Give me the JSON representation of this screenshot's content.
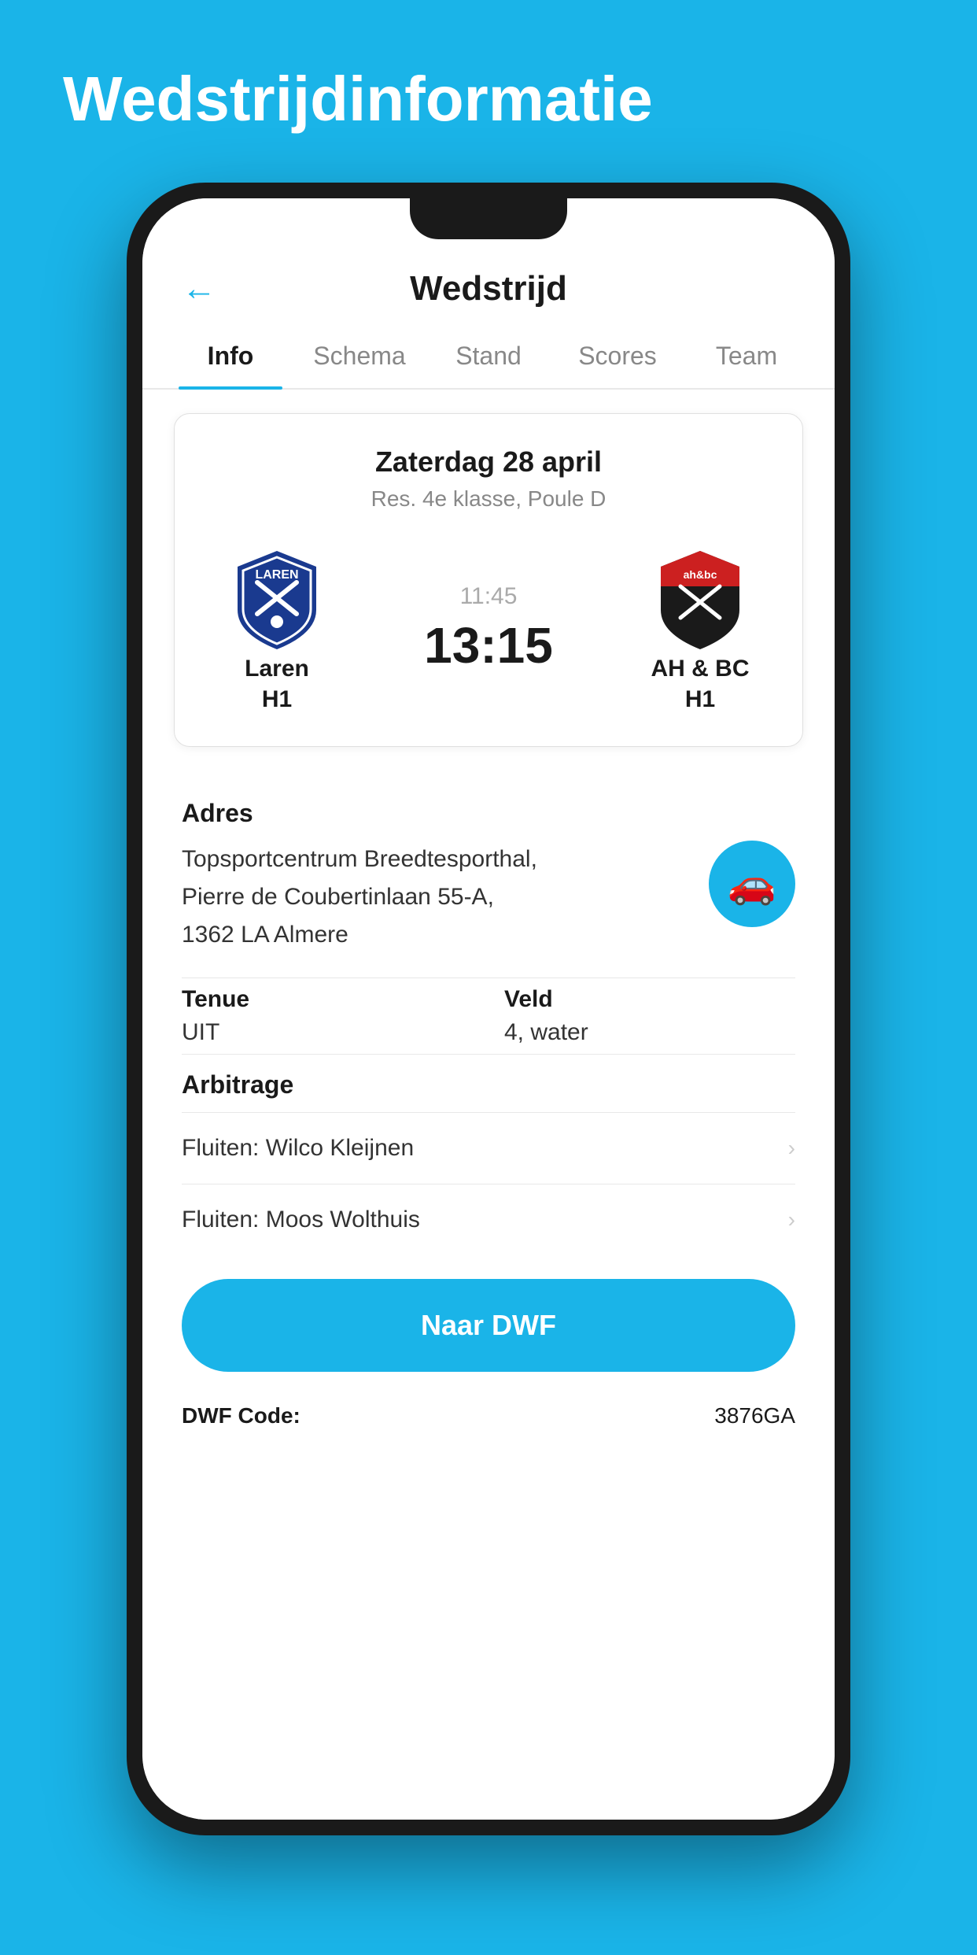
{
  "page": {
    "bg_title": "Wedstrijdinformatie",
    "header": {
      "title": "Wedstrijd",
      "back_label": "←"
    },
    "tabs": [
      {
        "label": "Info",
        "active": true
      },
      {
        "label": "Schema",
        "active": false
      },
      {
        "label": "Stand",
        "active": false
      },
      {
        "label": "Scores",
        "active": false
      },
      {
        "label": "Team",
        "active": false
      }
    ],
    "match": {
      "date": "Zaterdag 28 april",
      "league": "Res. 4e klasse, Poule D",
      "home_team": "Laren",
      "home_sub": "H1",
      "away_team": "AH & BC",
      "away_sub": "H1",
      "time_planned": "11:45",
      "score": "13:15"
    },
    "address": {
      "label": "Adres",
      "text_line1": "Topsportcentrum Breedtesporthal,",
      "text_line2": "Pierre de Coubertinlaan 55-A,",
      "text_line3": "1362 LA Almere"
    },
    "tenue": {
      "label": "Tenue",
      "value": "UIT"
    },
    "veld": {
      "label": "Veld",
      "value": "4, water"
    },
    "arbitrage": {
      "label": "Arbitrage",
      "items": [
        {
          "text": "Fluiten: Wilco Kleijnen"
        },
        {
          "text": "Fluiten: Moos Wolthuis"
        }
      ]
    },
    "naar_dwf": {
      "label": "Naar DWF"
    },
    "dwf_code": {
      "label": "DWF Code:",
      "value": "3876GA"
    }
  }
}
